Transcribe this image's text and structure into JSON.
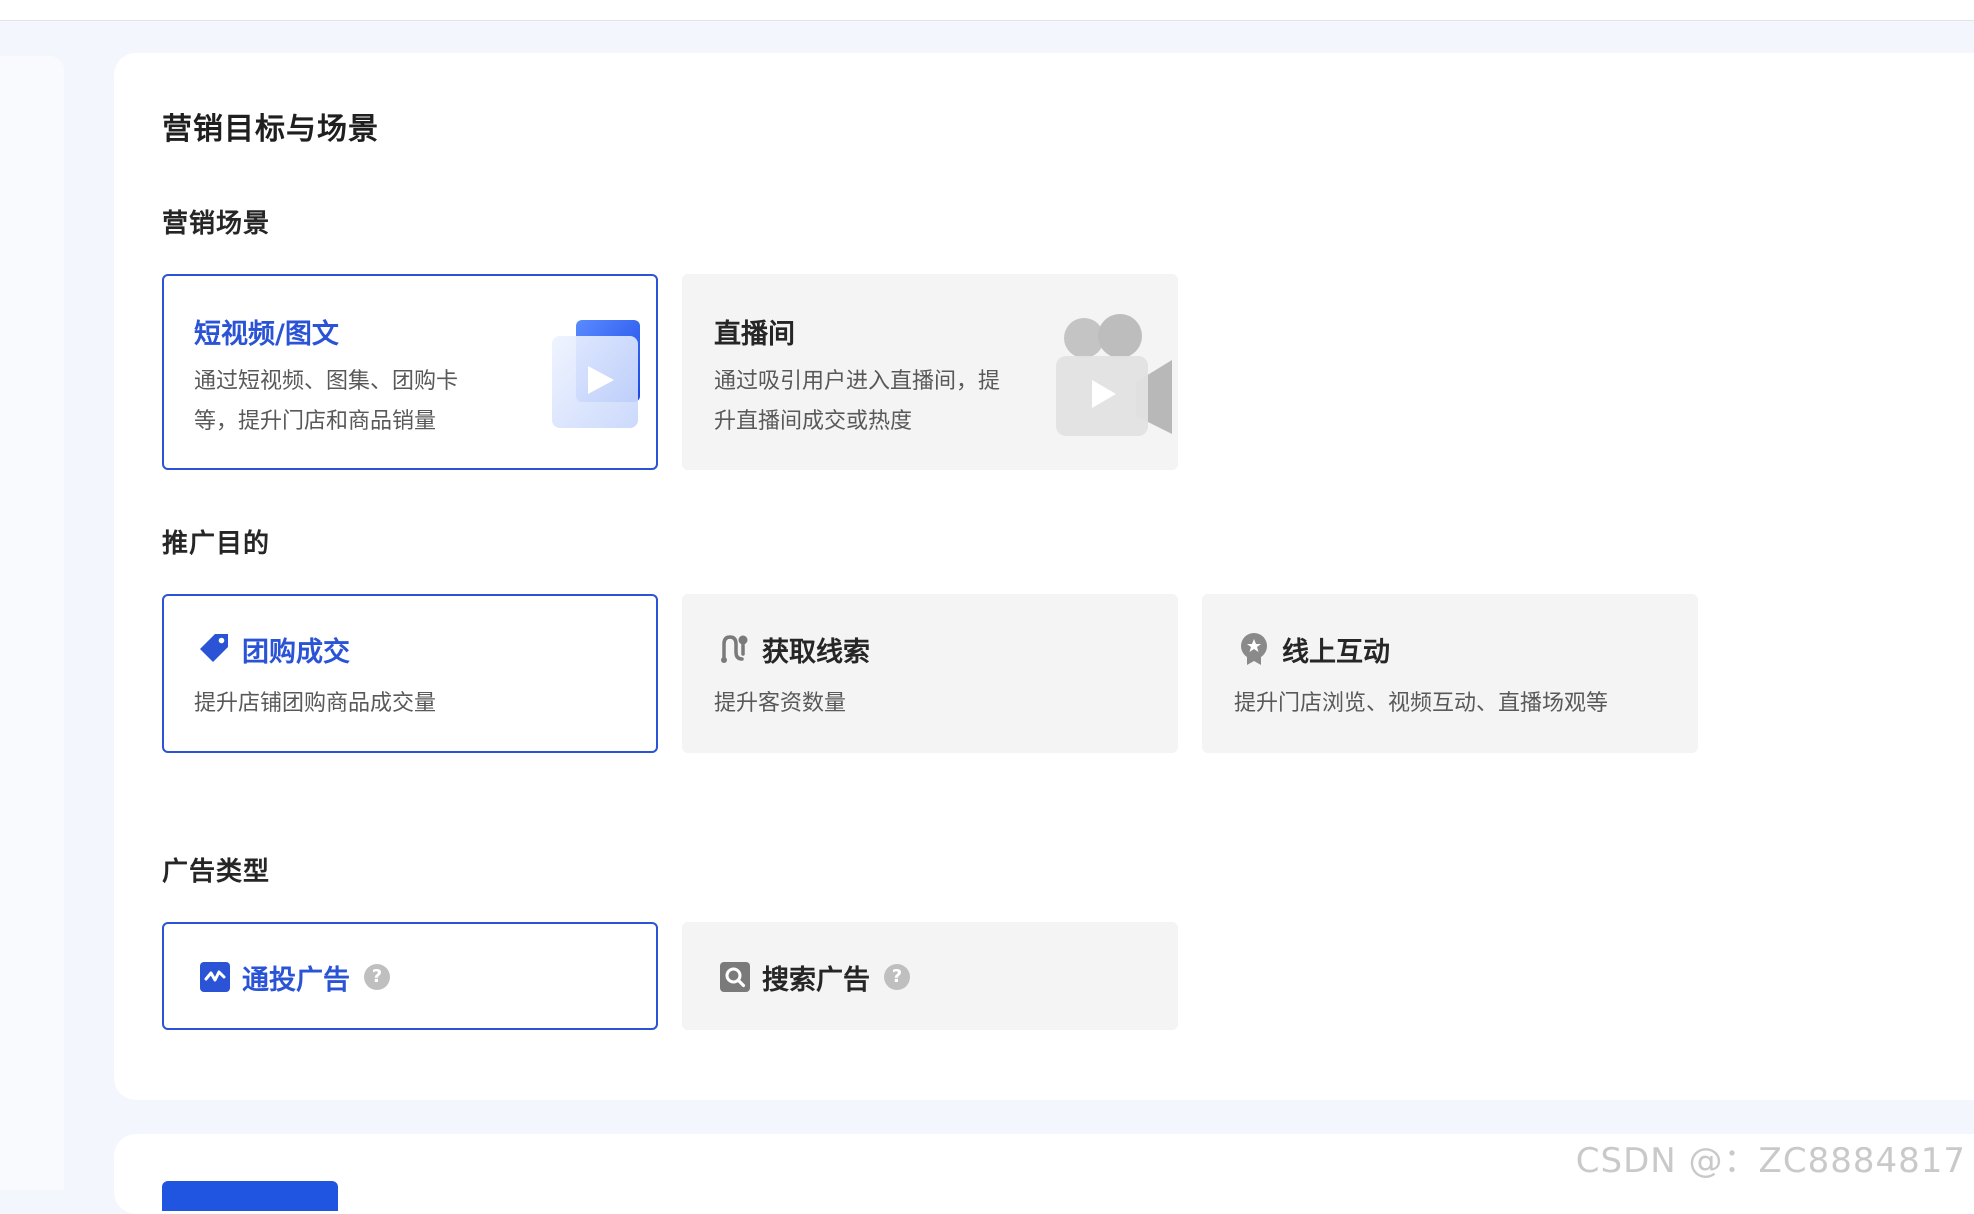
{
  "page": {
    "title": "营销目标与场景"
  },
  "sections": {
    "scene": {
      "title": "营销场景",
      "options": [
        {
          "title": "短视频/图文",
          "desc_line1": "通过短视频、图集、团购卡",
          "desc_line2": "等，提升门店和商品销量",
          "selected": true,
          "icon": "video-card-illustration"
        },
        {
          "title": "直播间",
          "desc_line1": "通过吸引用户进入直播间，提",
          "desc_line2": "升直播间成交或热度",
          "selected": false,
          "icon": "live-camera-illustration"
        }
      ]
    },
    "purpose": {
      "title": "推广目的",
      "options": [
        {
          "title": "团购成交",
          "desc": "提升店铺团购商品成交量",
          "selected": true,
          "icon": "tag-icon"
        },
        {
          "title": "获取线索",
          "desc": "提升客资数量",
          "selected": false,
          "icon": "leads-icon"
        },
        {
          "title": "线上互动",
          "desc": "提升门店浏览、视频互动、直播场观等",
          "selected": false,
          "icon": "badge-icon"
        }
      ]
    },
    "ad_type": {
      "title": "广告类型",
      "options": [
        {
          "title": "通投广告",
          "help": "?",
          "selected": true,
          "icon": "trend-icon"
        },
        {
          "title": "搜索广告",
          "help": "?",
          "selected": false,
          "icon": "search-icon"
        }
      ]
    }
  },
  "watermark": "CSDN @：ZC8884817",
  "colors": {
    "accent": "#2a53d6",
    "primary_button": "#1f55e0",
    "option_bg": "#f4f4f5",
    "page_bg": "#f3f6fc"
  }
}
